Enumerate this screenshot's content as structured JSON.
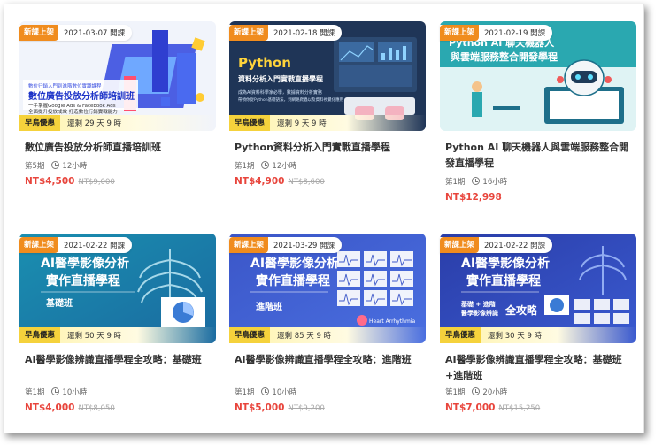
{
  "courses": [
    {
      "tag": "新課上架",
      "date": "2021-03-07 開課",
      "promo_label": "早鳥優惠",
      "promo_remaining": "還剩 29 天 9 時",
      "title": "數位廣告投放分析師直播培訓班",
      "session": "第5期",
      "hours": "12小時",
      "price": "NT$4,500",
      "original_price": "NT$9,000",
      "banner": {
        "caption_small": "數位行銷入門到進階數位實踐課程",
        "heading": "數位廣告投放分析師培訓班",
        "line1": "一手掌握Google Ads & Facebook Ads",
        "line2": "全面提升投放成效 打造數位行銷實戰能力"
      }
    },
    {
      "tag": "新課上架",
      "date": "2021-02-18 開課",
      "promo_label": "早鳥優惠",
      "promo_remaining": "還剩 9 天 9 時",
      "title": "Python資料分析入門實戰直播學程",
      "session": "第1期",
      "hours": "12小時",
      "price": "NT$4,900",
      "original_price": "NT$8,600",
      "banner": {
        "heading": "Python",
        "sub": "資料分析入門實戰直播學程",
        "line1": "成為AI資料科學家必學，數據資料分析實務",
        "line2": "帶領你從Python基礎語法，到網路爬蟲以及資料視覺化應用"
      }
    },
    {
      "tag": "新課上架",
      "date": "2021-02-19 開課",
      "promo_label": "",
      "promo_remaining": "",
      "title": "Python AI 聊天機器人與雲端服務整合開發直播學程",
      "session": "第1期",
      "hours": "16小時",
      "price": "NT$12,998",
      "original_price": "",
      "banner": {
        "heading": "Python AI 聊天機器人",
        "sub": "與雲端服務整合開發學程"
      }
    },
    {
      "tag": "新課上架",
      "date": "2021-02-22 開課",
      "promo_label": "早鳥優惠",
      "promo_remaining": "還剩 50 天 9 時",
      "title": "AI醫學影像辨識直播學程全攻略：基礎班",
      "session": "第1期",
      "hours": "10小時",
      "price": "NT$4,000",
      "original_price": "NT$8,050",
      "banner": {
        "heading": "AI醫學影像分析",
        "sub": "實作直播學程",
        "level": "基礎班"
      }
    },
    {
      "tag": "新課上架",
      "date": "2021-03-29 開課",
      "promo_label": "早鳥優惠",
      "promo_remaining": "還剩 85 天 9 時",
      "title": "AI醫學影像辨識直播學程全攻略：進階班",
      "session": "第1期",
      "hours": "10小時",
      "price": "NT$5,000",
      "original_price": "NT$9,200",
      "banner": {
        "heading": "AI醫學影像分析",
        "sub": "實作直播學程",
        "level": "進階班",
        "caption": "Heart Arrhythmia"
      }
    },
    {
      "tag": "新課上架",
      "date": "2021-02-22 開課",
      "promo_label": "早鳥優惠",
      "promo_remaining": "還剩 30 天 9 時",
      "title": "AI醫學影像辨識直播學程全攻略：基礎班+進階班",
      "session": "第1期",
      "hours": "20小時",
      "price": "NT$7,000",
      "original_price": "NT$15,250",
      "banner": {
        "heading": "AI醫學影像分析",
        "sub": "實作直播學程",
        "level_top": "基礎 + 進階",
        "level_bottom": "醫學影像辨識",
        "level_big": "全攻略"
      }
    }
  ],
  "colors": {
    "new_tag": "#f08c1e",
    "promo_tag": "#f5d23c",
    "price": "#e8453c",
    "old_price": "#aaaaaa"
  },
  "icons": {
    "duration": "clock-icon"
  }
}
